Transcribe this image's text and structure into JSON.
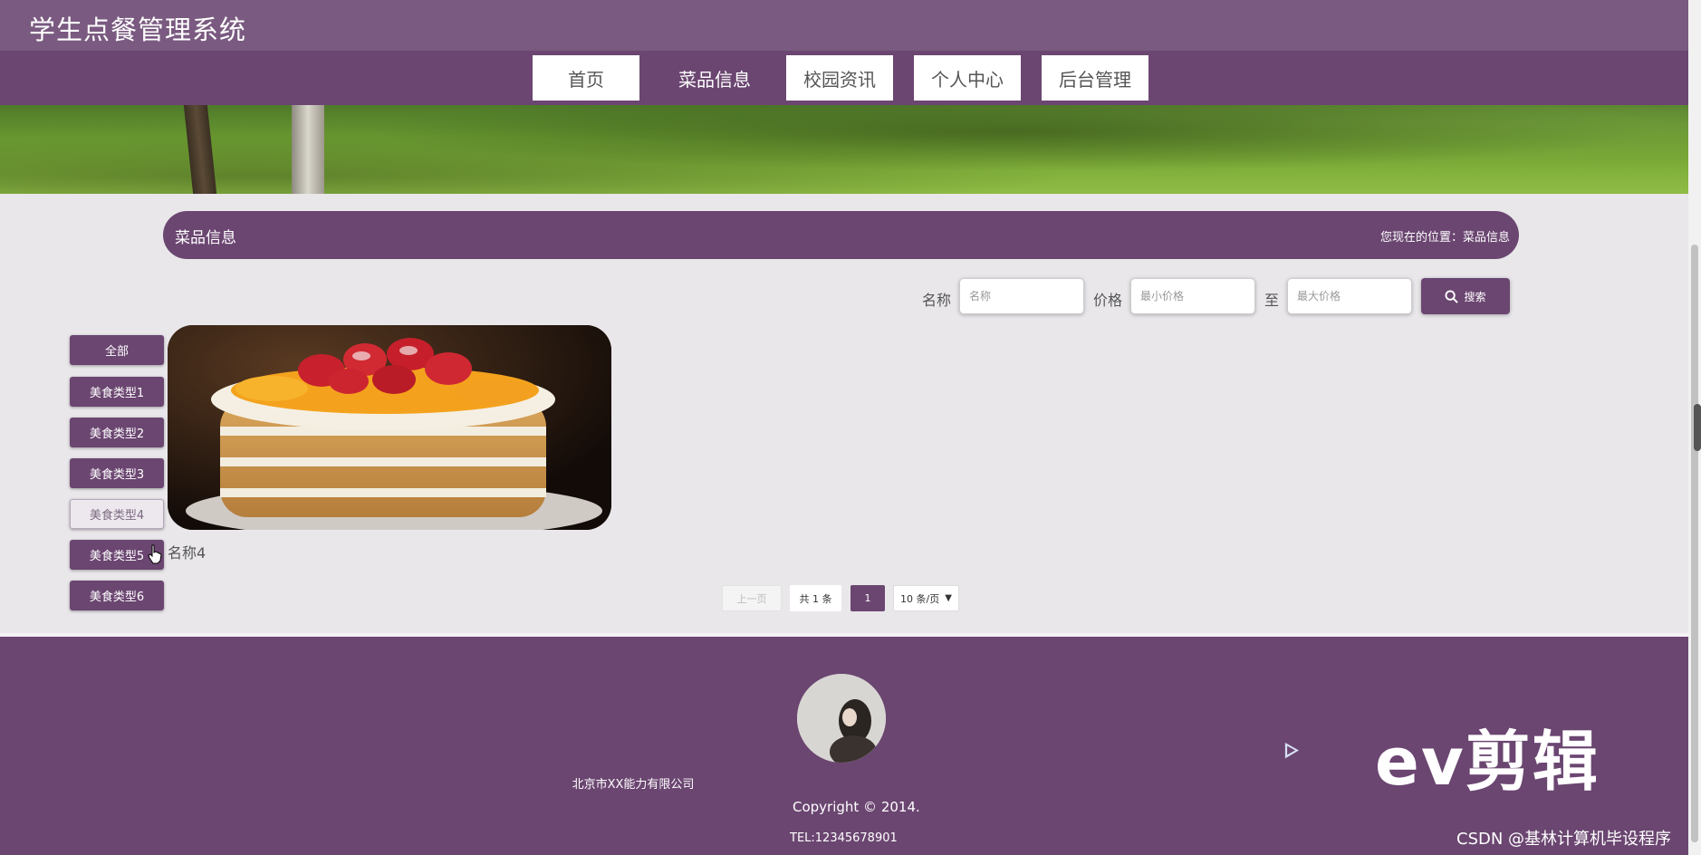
{
  "header": {
    "site_title": "学生点餐管理系统"
  },
  "nav": {
    "items": [
      {
        "label": "首页",
        "active": false
      },
      {
        "label": "菜品信息",
        "active": true
      },
      {
        "label": "校园资讯",
        "active": false
      },
      {
        "label": "个人中心",
        "active": false
      },
      {
        "label": "后台管理",
        "active": false
      }
    ]
  },
  "section": {
    "title": "菜品信息",
    "breadcrumb": "您现在的位置：菜品信息"
  },
  "search": {
    "name_label": "名称",
    "name_placeholder": "名称",
    "price_label": "价格",
    "min_price_placeholder": "最小价格",
    "to_label": "至",
    "max_price_placeholder": "最大价格",
    "button_label": "搜索",
    "button_icon": "search-icon"
  },
  "categories": [
    {
      "label": "全部",
      "selected": false
    },
    {
      "label": "美食类型1",
      "selected": false
    },
    {
      "label": "美食类型2",
      "selected": false
    },
    {
      "label": "美食类型3",
      "selected": false
    },
    {
      "label": "美食类型4",
      "selected": true
    },
    {
      "label": "美食类型5",
      "selected": false
    },
    {
      "label": "美食类型6",
      "selected": false
    }
  ],
  "foods": [
    {
      "name": "名称4",
      "image": "strawberry-peach-layer-cake"
    }
  ],
  "pagination": {
    "prev_label": "上一页",
    "total_label": "共 1 条",
    "current_page": "1",
    "page_size_label": "10 条/页"
  },
  "footer": {
    "company": "北京市XX能力有限公司",
    "copyright": "Copyright © 2014.",
    "tel": "TEL:12345678901"
  },
  "overlay": {
    "ev_brand": "ev剪辑",
    "watermark": "CSDN @基林计算机毕设程序"
  },
  "colors": {
    "primary": "#6b4671",
    "topbar": "#7a5a80",
    "page_bg": "#e9e7ea"
  }
}
